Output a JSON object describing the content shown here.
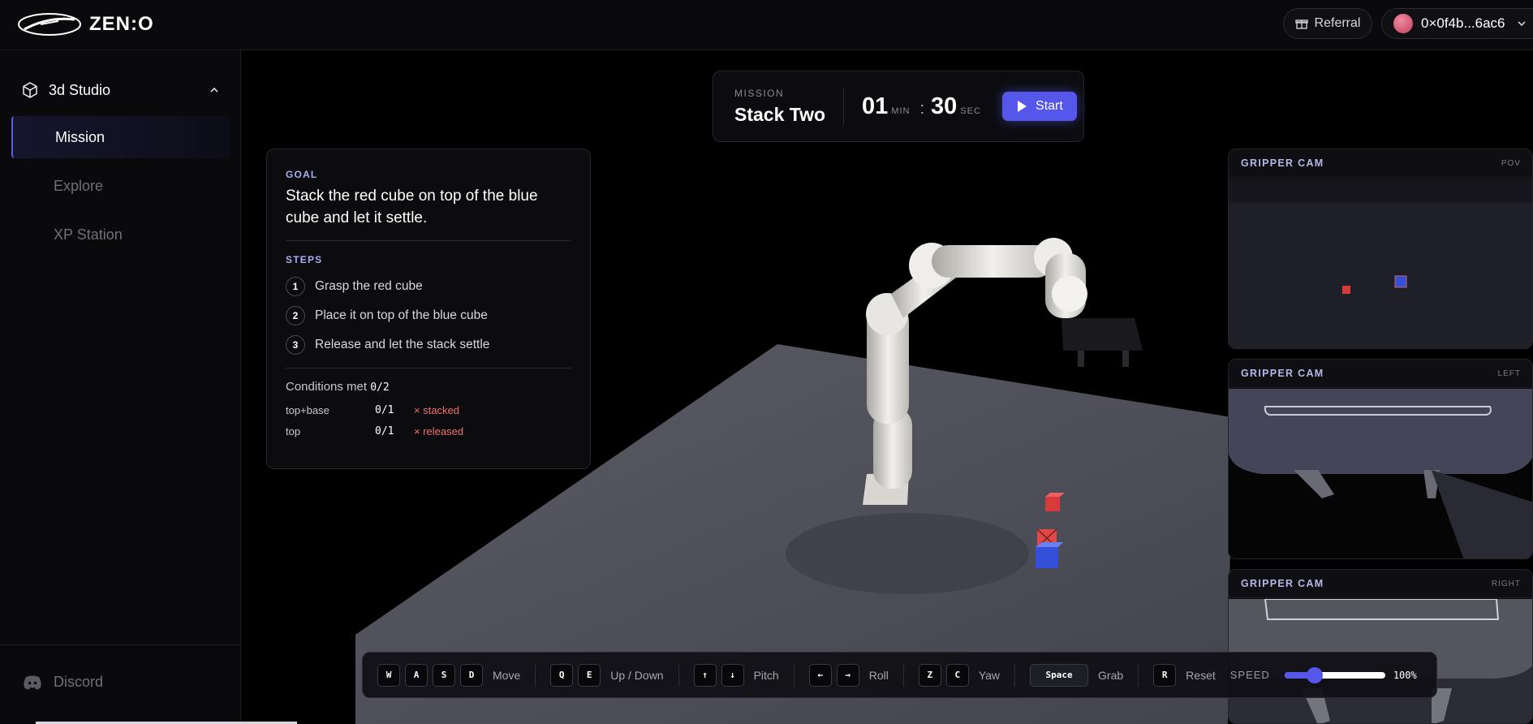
{
  "app": {
    "brand": "ZEN:O"
  },
  "header": {
    "referral_label": "Referral",
    "wallet_address": "0×0f4b...6ac6"
  },
  "sidebar": {
    "section_title": "3d Studio",
    "items": [
      {
        "label": "Mission",
        "active": true
      },
      {
        "label": "Explore",
        "active": false
      },
      {
        "label": "XP Station",
        "active": false
      }
    ],
    "footer_link": "Discord"
  },
  "mission": {
    "label": "MISSION",
    "name": "Stack Two",
    "timer_minutes": "01",
    "minutes_unit": "MIN",
    "separator": ":",
    "timer_seconds": "30",
    "seconds_unit": "SEC",
    "start_label": "Start"
  },
  "goal": {
    "label": "GOAL",
    "text": "Stack the red cube on top of the blue cube and let it settle.",
    "steps_label": "STEPS",
    "steps": [
      {
        "num": "1",
        "text": "Grasp the red cube"
      },
      {
        "num": "2",
        "text": "Place it on top of the blue cube"
      },
      {
        "num": "3",
        "text": "Release and let the stack settle"
      }
    ],
    "conditions_label": "Conditions met",
    "conditions_value": "0/2",
    "conditions": [
      {
        "name": "top+base",
        "value": "0/1",
        "status": "× stacked"
      },
      {
        "name": "top",
        "value": "0/1",
        "status": "× released"
      }
    ]
  },
  "cameras": [
    {
      "title": "GRIPPER CAM",
      "tag": "POV"
    },
    {
      "title": "GRIPPER CAM",
      "tag": "LEFT"
    },
    {
      "title": "GRIPPER CAM",
      "tag": "RIGHT"
    }
  ],
  "controls": {
    "groups": [
      {
        "keys": [
          "W",
          "A",
          "S",
          "D"
        ],
        "label": "Move"
      },
      {
        "keys": [
          "Q",
          "E"
        ],
        "label": "Up / Down"
      },
      {
        "keys": [
          "↑",
          "↓"
        ],
        "label": "Pitch"
      },
      {
        "keys": [
          "←",
          "→"
        ],
        "label": "Roll"
      },
      {
        "keys": [
          "Z",
          "C"
        ],
        "label": "Yaw"
      },
      {
        "keys": [
          "Space"
        ],
        "label": "Grab"
      },
      {
        "keys": [
          "R"
        ],
        "label": "Reset"
      }
    ],
    "speed_label": "SPEED",
    "speed_value": "100%",
    "speed_level": 0.3
  },
  "colors": {
    "accent": "#5557ea",
    "error": "#f07070",
    "red_cube": "#d63a3a",
    "blue_cube": "#3550d8"
  }
}
